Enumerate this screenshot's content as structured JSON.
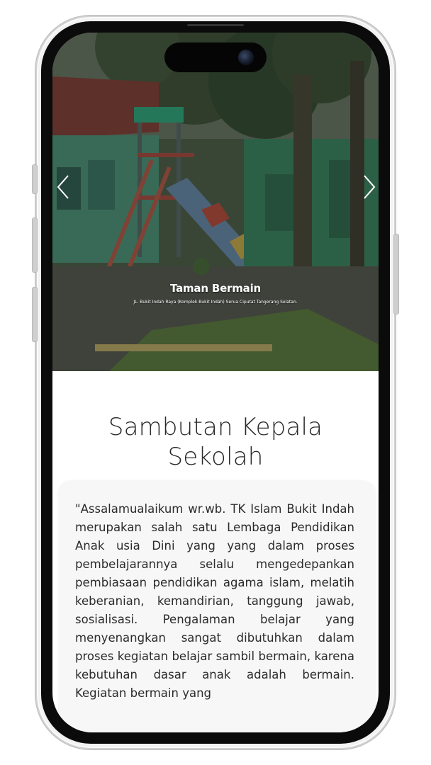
{
  "hero": {
    "title": "Taman Bermain",
    "address": "JL. Bukit Indah Raya (Komplek Bukit Indah) Serua Ciputat Tangerang Selatan.",
    "prev_icon": "chevron-left-icon",
    "next_icon": "chevron-right-icon"
  },
  "section": {
    "title": "Sambutan Kepala Sekolah"
  },
  "message": {
    "text": "\"Assalamualaikum wr.wb. TK Islam Bukit Indah merupakan salah satu Lembaga Pendidikan Anak usia Dini yang yang dalam proses pembelajarannya selalu mengedepankan pembiasaan pendidikan agama islam, melatih keberanian, kemandirian, tanggung jawab, sosialisasi. Pengalaman belajar yang menyenangkan sangat dibutuhkan dalam proses kegiatan belajar sambil bermain, karena kebutuhan dasar anak adalah bermain. Kegiatan bermain yang"
  },
  "colors": {
    "text_dark": "#2a2a2a",
    "card_bg": "#f7f7f8",
    "bezel": "#0b0b0b",
    "frame": "#f2f2f2"
  }
}
